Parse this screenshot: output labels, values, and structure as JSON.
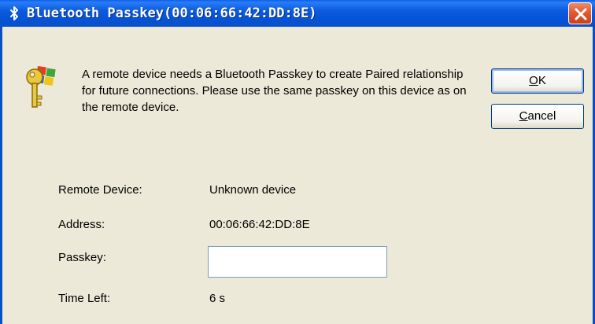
{
  "window": {
    "title": "Bluetooth Passkey(00:06:66:42:DD:8E)",
    "icons": {
      "title_icon": "bluetooth-icon",
      "close_icon": "close-icon",
      "dialog_icon": "key-windows-icon"
    },
    "colors": {
      "titlebar": "#0553d6",
      "dialog_bg": "#ece9d8",
      "close_button": "#e25a33"
    }
  },
  "dialog": {
    "message": "A remote device needs a Bluetooth Passkey to create Paired relationship for future connections. Please use the same passkey on this device as on the remote device."
  },
  "buttons": {
    "ok": {
      "mnemonic": "O",
      "rest": "K"
    },
    "cancel": {
      "mnemonic": "C",
      "rest": "ancel"
    }
  },
  "fields": {
    "remote_device": {
      "label": "Remote Device:",
      "value": "Unknown device"
    },
    "address": {
      "label": "Address:",
      "value": "00:06:66:42:DD:8E"
    },
    "passkey": {
      "label": "Passkey:",
      "value": ""
    },
    "time_left": {
      "label": "Time Left:",
      "value": "6 s"
    }
  }
}
